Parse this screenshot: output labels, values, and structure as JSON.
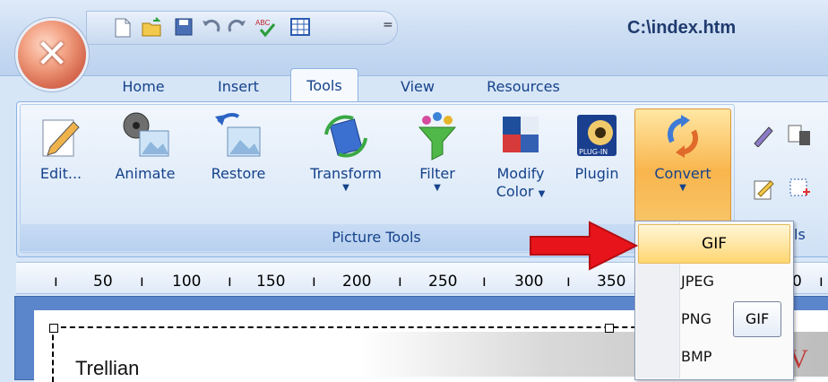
{
  "app": {
    "window_title": "C:\\index.htm"
  },
  "quick_access": {
    "icons": [
      "new-document-icon",
      "open-folder-icon",
      "save-icon",
      "undo-icon",
      "redo-icon",
      "spellcheck-icon",
      "table-icon"
    ],
    "spellcheck_text": "ABC",
    "more": "="
  },
  "tabs": [
    {
      "label": "Home",
      "active": false
    },
    {
      "label": "Insert",
      "active": false
    },
    {
      "label": "Tools",
      "active": true
    },
    {
      "label": "View",
      "active": false
    },
    {
      "label": "Resources",
      "active": false
    }
  ],
  "ribbon": {
    "group_label": "Picture Tools",
    "group_label_right": "ls",
    "buttons": [
      {
        "label": "Edit...",
        "icon": "pencil-icon"
      },
      {
        "label": "Animate",
        "icon": "film-reel-icon"
      },
      {
        "label": "Restore",
        "icon": "restore-icon"
      },
      {
        "label": "Transform",
        "icon": "transform-icon",
        "dropdown": true
      },
      {
        "label": "Filter",
        "icon": "funnel-icon",
        "dropdown": true
      },
      {
        "label": "Modify",
        "label2": "Color",
        "icon": "color-squares-icon",
        "dropdown": true
      },
      {
        "label": "Plugin",
        "icon": "plugin-icon",
        "badge": "PLUG-IN"
      },
      {
        "label": "Convert",
        "icon": "convert-icon",
        "dropdown": true,
        "active": true
      }
    ]
  },
  "ruler": {
    "marks": [
      "50",
      "100",
      "150",
      "200",
      "250",
      "300",
      "350",
      "0"
    ]
  },
  "document": {
    "logo_text": "Trellian",
    "banner_letters": "AV"
  },
  "convert_menu": {
    "items": [
      {
        "label": "GIF",
        "highlighted": true
      },
      {
        "label": "JPEG"
      },
      {
        "label": "PNG"
      },
      {
        "label": "BMP"
      }
    ],
    "tooltip": "GIF"
  },
  "colors": {
    "accent": "#f9b54d",
    "ribbon_text": "#15428b",
    "arrow": "#e8141b"
  }
}
